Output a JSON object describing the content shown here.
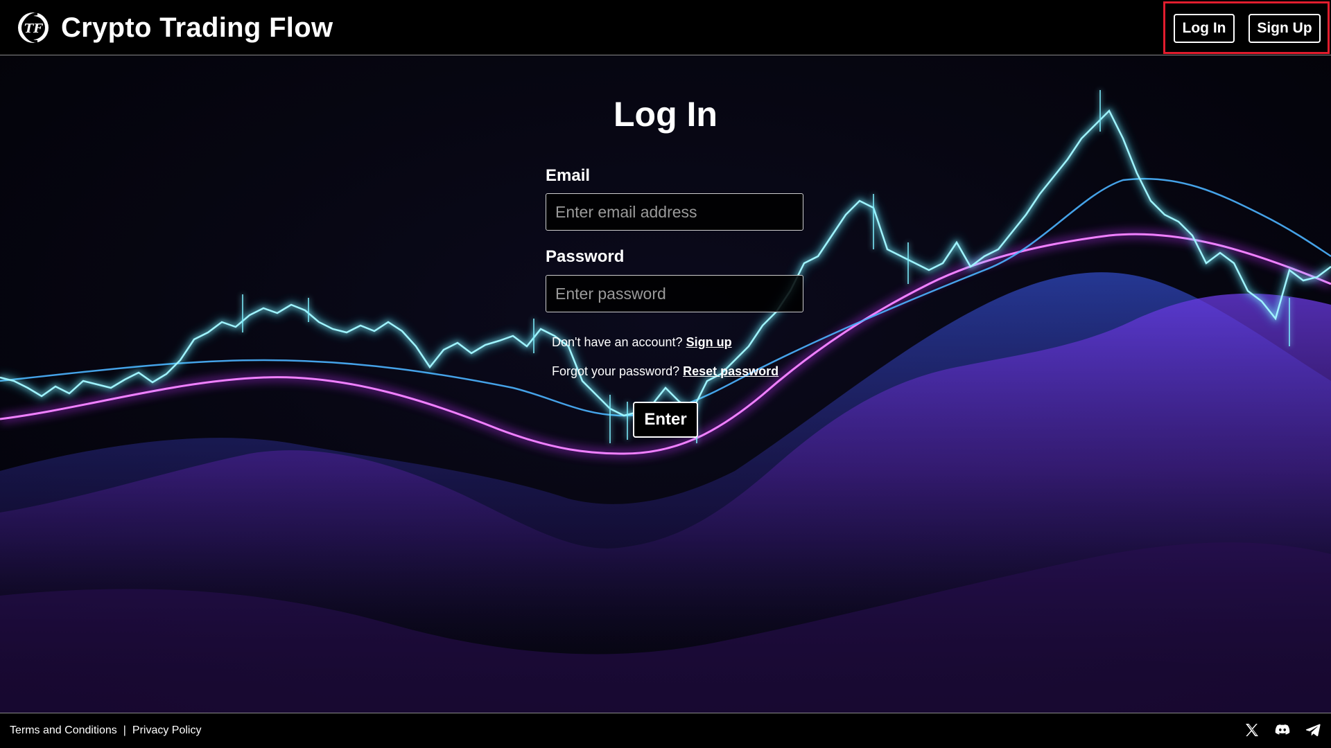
{
  "header": {
    "logo_text": "TF",
    "title": "Crypto Trading Flow",
    "login_label": "Log In",
    "signup_label": "Sign Up"
  },
  "form": {
    "heading": "Log In",
    "email_label": "Email",
    "email_placeholder": "Enter email address",
    "email_value": "",
    "password_label": "Password",
    "password_placeholder": "Enter password",
    "password_value": "",
    "no_account_text": "Don't have an account?",
    "signup_link": "Sign up",
    "forgot_text": "Forgot your password?",
    "reset_link": "Reset password",
    "submit_label": "Enter"
  },
  "footer": {
    "terms_label": "Terms and Conditions",
    "separator": "|",
    "privacy_label": "Privacy Policy",
    "social_icons": [
      "x-icon",
      "discord-icon",
      "telegram-icon"
    ]
  },
  "colors": {
    "highlight_border": "#e11d2e",
    "glow_cyan": "#39e6ff",
    "glow_magenta": "#d23cff",
    "background": "#05040c"
  }
}
